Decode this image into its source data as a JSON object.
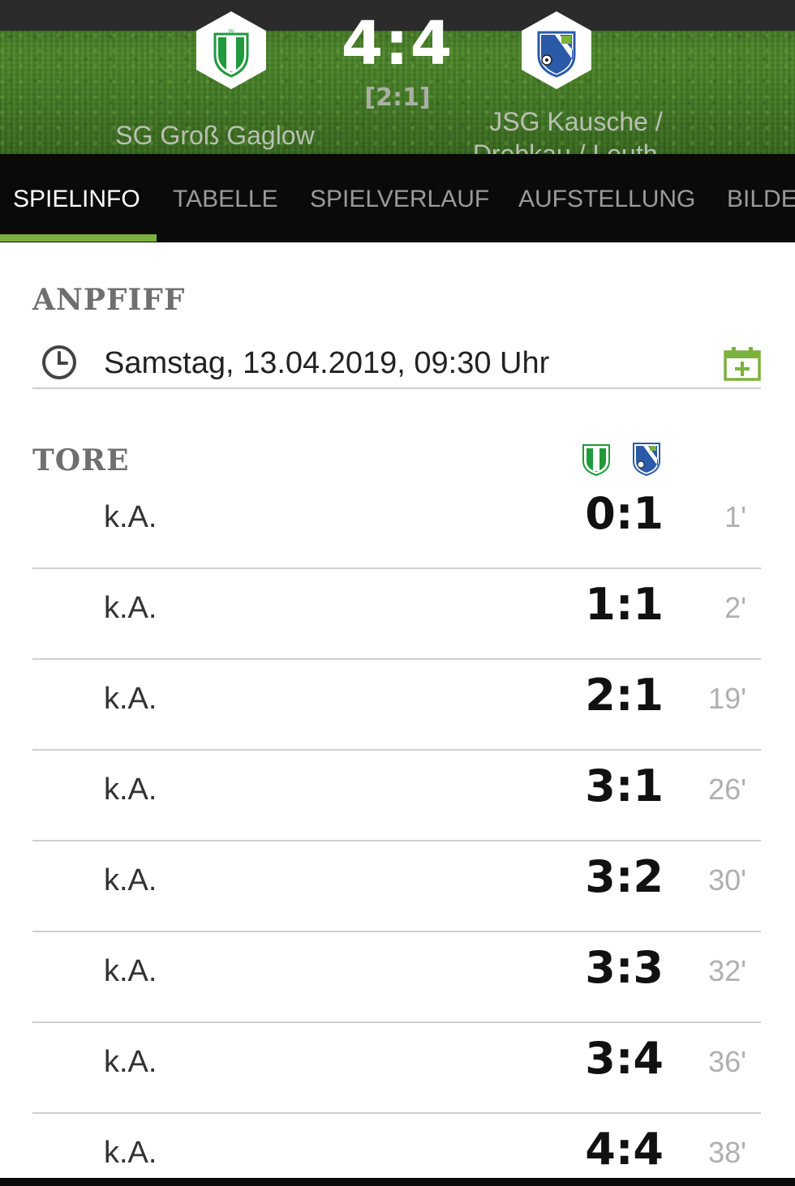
{
  "match": {
    "score": "4:4",
    "halftime": "[2:1]",
    "home": {
      "name": "SG Groß Gaglow",
      "badge_icon": "shield-green-icon"
    },
    "away": {
      "name": "JSG Kausche / Drebkau / Leuth...",
      "badge_icon": "shield-blue-icon"
    }
  },
  "tabs": [
    {
      "label": "SPIELINFO",
      "active": true
    },
    {
      "label": "TABELLE",
      "active": false
    },
    {
      "label": "SPIELVERLAUF",
      "active": false
    },
    {
      "label": "AUFSTELLUNG",
      "active": false
    },
    {
      "label": "BILDER",
      "active": false
    }
  ],
  "kickoff": {
    "title": "ANPFIFF",
    "datetime": "Samstag, 13.04.2019, 09:30 Uhr",
    "clock_icon": "clock-icon",
    "calendar_icon": "calendar-add-icon"
  },
  "goals": {
    "title": "TORE",
    "rows": [
      {
        "player": "k.A.",
        "score": "0:1",
        "minute": "1'"
      },
      {
        "player": "k.A.",
        "score": "1:1",
        "minute": "2'"
      },
      {
        "player": "k.A.",
        "score": "2:1",
        "minute": "19'"
      },
      {
        "player": "k.A.",
        "score": "3:1",
        "minute": "26'"
      },
      {
        "player": "k.A.",
        "score": "3:2",
        "minute": "30'"
      },
      {
        "player": "k.A.",
        "score": "3:3",
        "minute": "32'"
      },
      {
        "player": "k.A.",
        "score": "3:4",
        "minute": "36'"
      },
      {
        "player": "k.A.",
        "score": "4:4",
        "minute": "38'"
      }
    ]
  },
  "colors": {
    "accent": "#7bb23c",
    "home_green": "#1f9a3c",
    "away_blue": "#2a5aa8",
    "tab_bar": "#0a0a0a"
  }
}
